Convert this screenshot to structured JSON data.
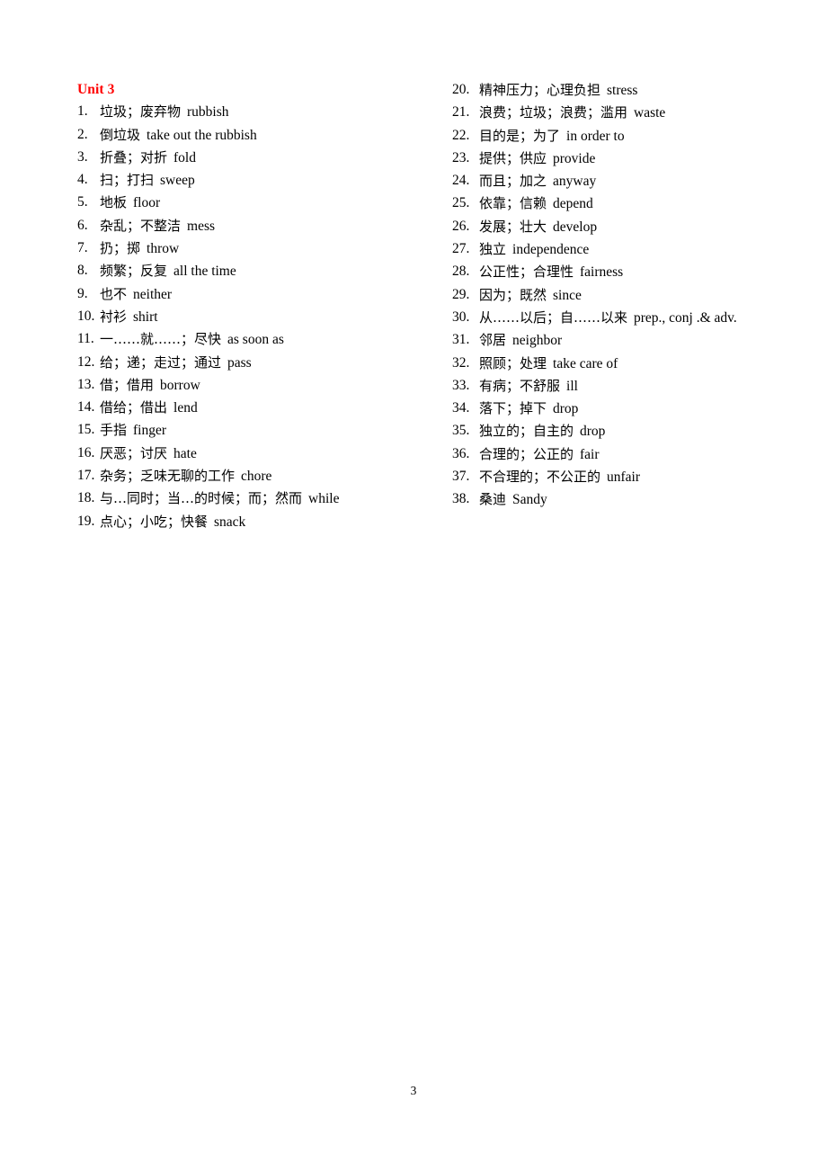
{
  "document": {
    "unit_title": "Unit 3",
    "page_number": "3"
  },
  "columns": {
    "left": [
      {
        "num": "1.",
        "zh": "垃圾；废弃物",
        "en": "rubbish"
      },
      {
        "num": "2.",
        "zh": "倒垃圾",
        "en": "take out the rubbish"
      },
      {
        "num": "3.",
        "zh": "折叠；对折",
        "en": "fold"
      },
      {
        "num": "4.",
        "zh": "扫；打扫",
        "en": "sweep"
      },
      {
        "num": "5.",
        "zh": "地板",
        "en": "floor"
      },
      {
        "num": "6.",
        "zh": "杂乱；不整洁",
        "en": "mess"
      },
      {
        "num": "7.",
        "zh": "扔；掷",
        "en": "throw"
      },
      {
        "num": "8.",
        "zh": "频繁；反复",
        "en": "all the time"
      },
      {
        "num": "9.",
        "zh": "也不",
        "en": "neither"
      },
      {
        "num": "10.",
        "zh": "衬衫",
        "en": "shirt"
      },
      {
        "num": "11.",
        "zh": "一……就……；尽快",
        "en": "as soon as"
      },
      {
        "num": "12.",
        "zh": "给；递；走过；通过",
        "en": "pass"
      },
      {
        "num": "13.",
        "zh": "借；借用",
        "en": "borrow"
      },
      {
        "num": "14.",
        "zh": "借给；借出",
        "en": "lend"
      },
      {
        "num": "15.",
        "zh": "手指",
        "en": "finger"
      },
      {
        "num": "16.",
        "zh": "厌恶；讨厌",
        "en": "hate"
      },
      {
        "num": "17.",
        "zh": "杂务；乏味无聊的工作",
        "en": "chore"
      },
      {
        "num": "18.",
        "zh": "与…同时；当…的时候；而；然而",
        "en": "while"
      },
      {
        "num": "19.",
        "zh": "点心；小吃；快餐",
        "en": "snack"
      }
    ],
    "right": [
      {
        "num": "20.",
        "zh": "精神压力；心理负担",
        "en": "stress"
      },
      {
        "num": "21.",
        "zh": "浪费；垃圾；浪费；滥用",
        "en": "waste"
      },
      {
        "num": "22.",
        "zh": "目的是；为了",
        "en": "in order to"
      },
      {
        "num": "23.",
        "zh": "提供；供应",
        "en": "provide"
      },
      {
        "num": "24.",
        "zh": "而且；加之",
        "en": "anyway"
      },
      {
        "num": "25.",
        "zh": "依靠；信赖",
        "en": "depend"
      },
      {
        "num": "26.",
        "zh": "发展；壮大",
        "en": "develop"
      },
      {
        "num": "27.",
        "zh": "独立",
        "en": "independence"
      },
      {
        "num": "28.",
        "zh": "公正性；合理性",
        "en": "fairness"
      },
      {
        "num": "29.",
        "zh": "因为；既然",
        "en": "since"
      },
      {
        "num": "30.",
        "zh": "从……以后；自……以来",
        "en": "prep., conj .& adv.",
        "wrap": true
      },
      {
        "num": "31.",
        "zh": "邻居",
        "en": "neighbor"
      },
      {
        "num": "32.",
        "zh": "照顾；处理",
        "en": "take care of"
      },
      {
        "num": "33.",
        "zh": "有病；不舒服",
        "en": "ill"
      },
      {
        "num": "34.",
        "zh": "落下；掉下",
        "en": "drop"
      },
      {
        "num": "35.",
        "zh": "独立的；自主的",
        "en": "drop"
      },
      {
        "num": "36.",
        "zh": "合理的；公正的",
        "en": "fair"
      },
      {
        "num": "37.",
        "zh": "不合理的；不公正的",
        "en": "unfair"
      },
      {
        "num": "38.",
        "zh": "桑迪",
        "en": "Sandy"
      }
    ]
  },
  "colors": {
    "title": "#ff0000",
    "text": "#000000",
    "background": "#ffffff"
  }
}
